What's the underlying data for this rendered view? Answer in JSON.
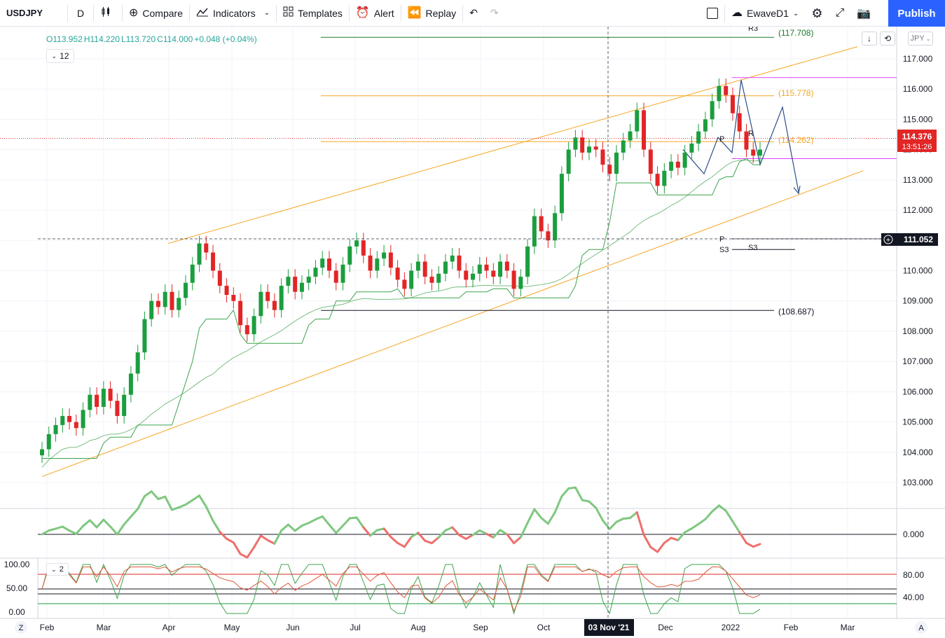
{
  "toolbar": {
    "symbol": "USDJPY",
    "interval": "D",
    "compare": "Compare",
    "indicators": "Indicators",
    "templates": "Templates",
    "alert": "Alert",
    "replay": "Replay",
    "layout_name": "EwaveD1",
    "publish": "Publish"
  },
  "legend": {
    "open": "O113.952",
    "high": "H114.220",
    "low": "L113.720",
    "close": "C114.000",
    "change": "+0.048 (+0.04%)",
    "indicator_length": "12",
    "stoch_length": "2"
  },
  "currency": "JPY",
  "colors": {
    "up": "#1b9e3e",
    "down": "#e22525",
    "channel": "#f5a623",
    "pivot_magenta": "#e040fb",
    "projection": "#2a4f8a",
    "accent": "#2962ff"
  },
  "price_axis": {
    "labels": [
      "117.000",
      "116.000",
      "115.000",
      "114.000",
      "113.000",
      "112.000",
      "111.000",
      "110.000",
      "109.000",
      "108.000",
      "107.000",
      "106.000",
      "105.000",
      "104.000",
      "103.000"
    ],
    "current_price": "114.376",
    "countdown": "13:51:26",
    "crosshair_price": "111.052"
  },
  "levels": {
    "r3_top": "R3",
    "r3_value": "(117.708)",
    "level_115": "(115.778)",
    "level_114": "(114.262)",
    "level_108": "(108.687)",
    "p_label": "P",
    "r1_label": "R",
    "p_lower": "P",
    "s3_left": "S3",
    "s3_right": "S3"
  },
  "oscillator_axis": {
    "zero": "0.000"
  },
  "stoch_axis": {
    "left": [
      "100.00",
      "50.00",
      "0.00"
    ],
    "right": [
      "80.00",
      "40.00"
    ]
  },
  "time_axis": {
    "labels": [
      "Feb",
      "Mar",
      "Apr",
      "May",
      "Jun",
      "Jul",
      "Aug",
      "Sep",
      "Oct",
      "Dec",
      "2022",
      "Feb",
      "Mar"
    ],
    "crosshair_date": "03 Nov '21",
    "zoom_btn": "Z",
    "auto_btn": "A"
  },
  "chart_data": {
    "type": "candlestick",
    "symbol": "USDJPY",
    "timeframe": "D",
    "y_range": [
      102.4,
      117.9
    ],
    "closes": [
      104.1,
      104.6,
      104.9,
      105.2,
      105.0,
      104.8,
      105.4,
      105.9,
      105.5,
      106.1,
      105.7,
      105.2,
      105.9,
      106.6,
      107.3,
      108.4,
      109.0,
      108.8,
      109.3,
      108.7,
      109.1,
      109.6,
      110.2,
      110.9,
      110.6,
      110.0,
      109.5,
      109.2,
      109.0,
      108.2,
      107.9,
      108.5,
      109.3,
      109.0,
      108.7,
      109.5,
      109.8,
      109.3,
      109.6,
      109.8,
      110.1,
      110.4,
      110.0,
      109.6,
      110.2,
      110.8,
      111.0,
      110.5,
      110.0,
      110.4,
      110.6,
      110.1,
      109.7,
      109.4,
      110.0,
      110.3,
      109.8,
      109.6,
      109.9,
      110.3,
      110.5,
      110.0,
      109.7,
      109.9,
      110.2,
      110.0,
      109.8,
      110.3,
      110.0,
      109.4,
      109.8,
      110.8,
      111.8,
      111.3,
      111.0,
      111.9,
      113.2,
      114.0,
      114.4,
      113.9,
      114.1,
      114.0,
      113.5,
      113.2,
      113.9,
      114.3,
      114.6,
      115.3,
      114.0,
      113.2,
      112.8,
      113.3,
      113.6,
      113.4,
      113.9,
      114.2,
      114.6,
      115.0,
      115.6,
      116.1,
      115.8,
      115.2,
      114.6,
      114.0,
      113.8,
      114.0
    ],
    "pivot_levels": {
      "R3": 117.708,
      "upper": 115.778,
      "mid": 114.262,
      "lower": 108.687,
      "P": 111.052
    },
    "oscillator_zero": 0.0,
    "stoch_levels": [
      80,
      40
    ]
  }
}
